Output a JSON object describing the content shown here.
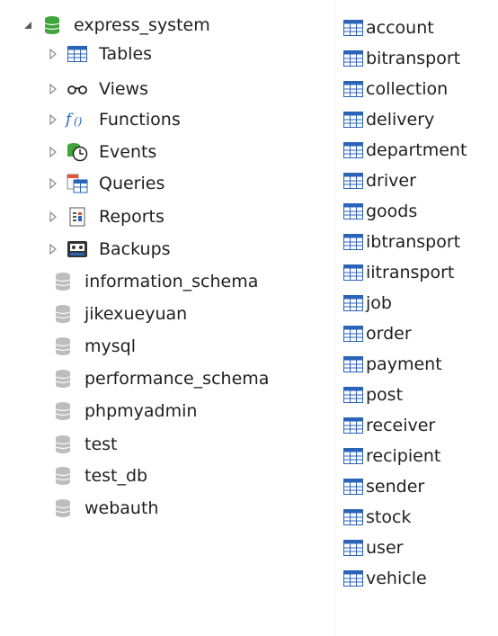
{
  "left_tree": {
    "root": {
      "label": "express_system"
    },
    "children": [
      {
        "label": "Tables",
        "icon": "table-icon"
      },
      {
        "label": "Views",
        "icon": "glasses-icon"
      },
      {
        "label": "Functions",
        "icon": "function-icon"
      },
      {
        "label": "Events",
        "icon": "clock-icon"
      },
      {
        "label": "Queries",
        "icon": "query-icon"
      },
      {
        "label": "Reports",
        "icon": "report-icon"
      },
      {
        "label": "Backups",
        "icon": "backup-icon"
      }
    ],
    "databases": [
      {
        "label": "information_schema"
      },
      {
        "label": "jikexueyuan"
      },
      {
        "label": "mysql"
      },
      {
        "label": "performance_schema"
      },
      {
        "label": "phpmyadmin"
      },
      {
        "label": "test"
      },
      {
        "label": "test_db"
      },
      {
        "label": "webauth"
      }
    ]
  },
  "right_list": {
    "items": [
      {
        "label": "account"
      },
      {
        "label": "bitransport"
      },
      {
        "label": "collection"
      },
      {
        "label": "delivery"
      },
      {
        "label": "department"
      },
      {
        "label": "driver"
      },
      {
        "label": "goods"
      },
      {
        "label": "ibtransport"
      },
      {
        "label": "iitransport"
      },
      {
        "label": "job"
      },
      {
        "label": "order"
      },
      {
        "label": "payment"
      },
      {
        "label": "post"
      },
      {
        "label": "receiver"
      },
      {
        "label": "recipient"
      },
      {
        "label": "sender"
      },
      {
        "label": "stock"
      },
      {
        "label": "user"
      },
      {
        "label": "vehicle"
      }
    ]
  },
  "colors": {
    "db_open": "#3fa43a",
    "db_closed": "#bdbdbd",
    "table_icon": "#2b63b8",
    "arrow": "#8a8a8a"
  }
}
